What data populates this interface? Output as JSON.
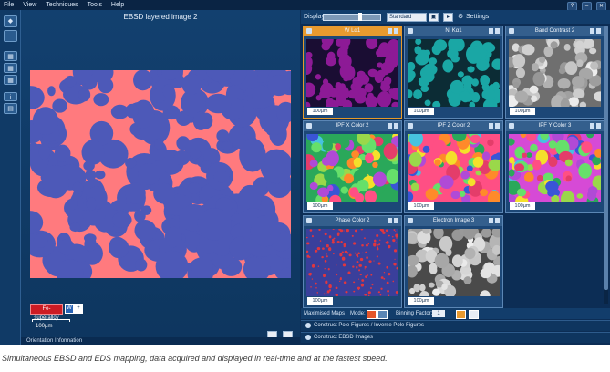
{
  "menubar": {
    "items": [
      "File",
      "View",
      "Techniques",
      "Tools",
      "Help"
    ],
    "window_buttons": [
      "?",
      "–",
      "✕"
    ]
  },
  "left_panel": {
    "title": "EBSD layered image 2",
    "phase_button_label": "Fe-superalloy",
    "scale_label": "100µm",
    "footer_label": "Orientation Information",
    "map_colors": {
      "background": "#ff7a7e",
      "grains": "#4d59b8"
    }
  },
  "toolbar": {
    "display_label": "Display",
    "display_mode": "Standard",
    "settings_label": "Settings",
    "slider_level": 0.65
  },
  "tiles": [
    {
      "title": "W Lα1",
      "scale": "100µm",
      "selected": true,
      "style": "wla",
      "bg": "#1a0d33",
      "fg": "#8d1a96"
    },
    {
      "title": "Ni Kα1",
      "scale": "100µm",
      "selected": false,
      "style": "nika",
      "bg": "#0c2c35",
      "fg": "#1aa7a5"
    },
    {
      "title": "Band Contrast 2",
      "scale": "100µm",
      "selected": false,
      "style": "bc",
      "bg": "#6f6f6f",
      "fg": "#d5d5d5"
    },
    {
      "title": "IPF X Color 2",
      "scale": "100µm",
      "selected": false,
      "style": "ipf",
      "bg": "#2aa85a",
      "fg": "#e43d6a"
    },
    {
      "title": "IPF Z Color 2",
      "scale": "100µm",
      "selected": false,
      "style": "ipf",
      "bg": "#ff4f84",
      "fg": "#47c2df"
    },
    {
      "title": "IPF Y Color 3",
      "scale": "100µm",
      "selected": false,
      "style": "ipf",
      "bg": "#d64ad6",
      "fg": "#f4e02b"
    },
    {
      "title": "Phase Color 2",
      "scale": "100µm",
      "selected": false,
      "style": "phase",
      "bg": "#3a3f9b",
      "fg": "#e0363f"
    },
    {
      "title": "Electron Image 3",
      "scale": "100µm",
      "selected": false,
      "style": "sem",
      "bg": "#4a4a4a",
      "fg": "#bcbcbc"
    }
  ],
  "bottom_bar": {
    "label": "Maximised Maps",
    "mode_label": "Mode:",
    "binning_label": "Binning Factor:",
    "binning_value": "1"
  },
  "expanders": [
    "Construct Pole Figures / Inverse Pole Figures",
    "Construct EBSD Images"
  ],
  "caption": "Simultaneous EBSD and EDS mapping, data acquired and displayed in real-time and at the fastest speed."
}
